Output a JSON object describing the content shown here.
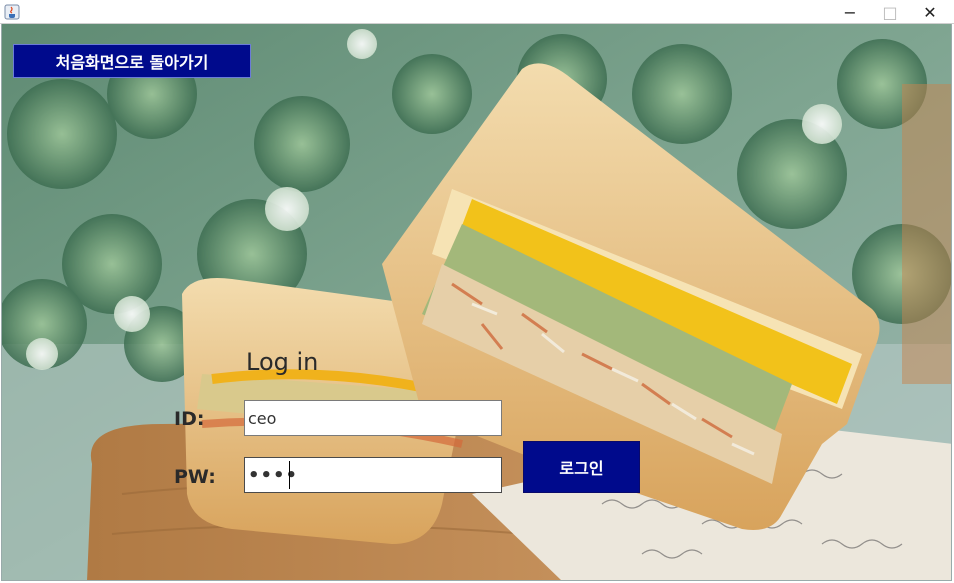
{
  "window": {
    "icon": "java-icon",
    "controls": {
      "minimize": "−",
      "maximize": "□",
      "close": "✕"
    }
  },
  "back_button": {
    "label": "처음화면으로 돌아가기"
  },
  "login": {
    "title": "Log in",
    "id_label": "ID:",
    "pw_label": "PW:",
    "id_value": "ceo",
    "pw_masked": "••••",
    "submit_label": "로그인"
  },
  "background": {
    "subject": "sandwich-photo"
  },
  "colors": {
    "button_bg": "#000a8c",
    "button_text": "#ffffff"
  }
}
